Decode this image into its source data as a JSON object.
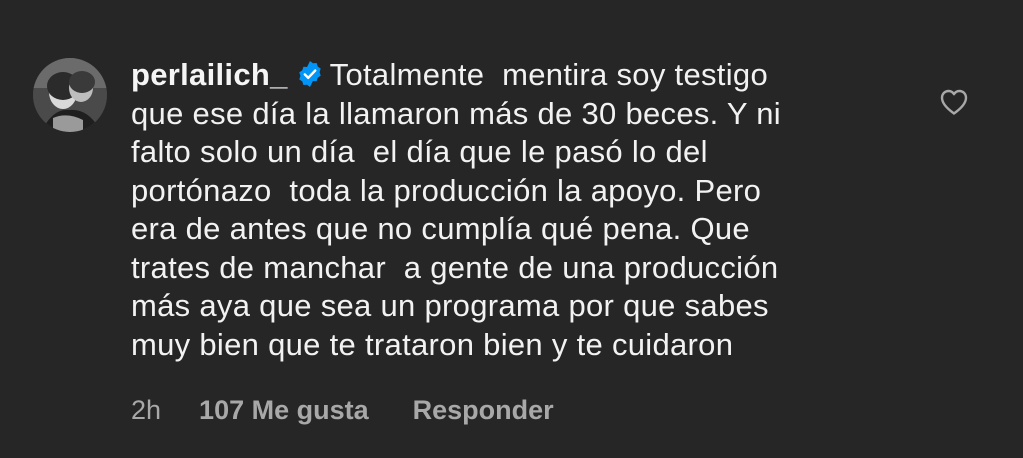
{
  "comment": {
    "username": "perlailich_",
    "verified": true,
    "lines": [
      "Totalmente  mentira soy testigo",
      "que ese día la llamaron más de 30 beces. Y ni",
      "falto solo un día  el día que le pasó lo del",
      "portónazo  toda la producción la apoyo. Pero",
      "era de antes que no cumplía qué pena. Que",
      "trates de manchar  a gente de una producción",
      "más aya que sea un programa por que sabes",
      "muy bien que te trataron bien y te cuidaron"
    ],
    "time": "2h",
    "likes": "107 Me gusta",
    "reply_label": "Responder"
  },
  "icons": {
    "verified": "verified-badge-icon",
    "like": "heart-outline-icon"
  },
  "colors": {
    "background": "#262626",
    "text": "#f2f2f2",
    "secondary_text": "#a8a8a8",
    "verified_blue": "#0095f6"
  }
}
